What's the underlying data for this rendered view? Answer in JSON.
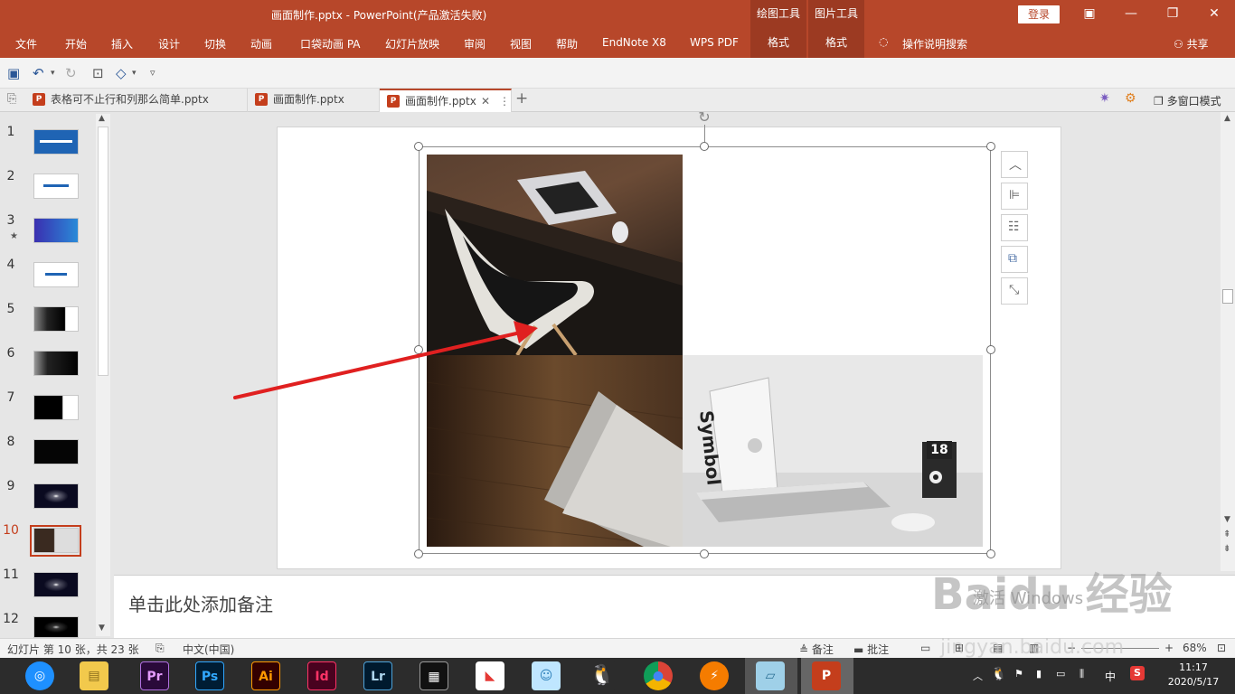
{
  "window": {
    "title": "画面制作.pptx  -  PowerPoint(产品激活失败)",
    "ctx_header_drawing": "绘图工具",
    "ctx_header_picture": "图片工具",
    "login": "登录"
  },
  "ribbon": {
    "tabs": [
      "文件",
      "开始",
      "插入",
      "设计",
      "切换",
      "动画",
      "口袋动画 PA",
      "幻灯片放映",
      "审阅",
      "视图",
      "帮助",
      "EndNote X8",
      "WPS PDF"
    ],
    "ctx_tab_1": "格式",
    "ctx_tab_2": "格式",
    "search": "操作说明搜索",
    "share": "共享"
  },
  "doc_tabs": [
    {
      "label": "表格可不止行和列那么简单.pptx"
    },
    {
      "label": "画面制作.pptx"
    },
    {
      "label": "画面制作.pptx"
    }
  ],
  "multiwindow": "多窗口模式",
  "slides": [
    {
      "num": "1"
    },
    {
      "num": "2"
    },
    {
      "num": "3"
    },
    {
      "num": "4"
    },
    {
      "num": "5"
    },
    {
      "num": "6"
    },
    {
      "num": "7"
    },
    {
      "num": "8"
    },
    {
      "num": "9"
    },
    {
      "num": "10"
    },
    {
      "num": "11"
    },
    {
      "num": "12"
    }
  ],
  "notes_placeholder": "单击此处添加备注",
  "status": {
    "slide_info": "幻灯片 第 10 张，共 23 张",
    "language": "中文(中国)",
    "notes": "备注",
    "comments": "批注",
    "zoom": "68%"
  },
  "taskbar": {
    "time": "11:17",
    "date": "2020/5/17",
    "ime": "中"
  },
  "picture_text": {
    "book": "Symbol",
    "calendar": "18"
  },
  "watermark": {
    "activate": "激活 Windows",
    "brand": "Baidu 经验",
    "url": "jingyan.baidu.com"
  },
  "colors": {
    "brand": "#b7472a",
    "accent": "#c43e1c",
    "arrow": "#e02020"
  }
}
